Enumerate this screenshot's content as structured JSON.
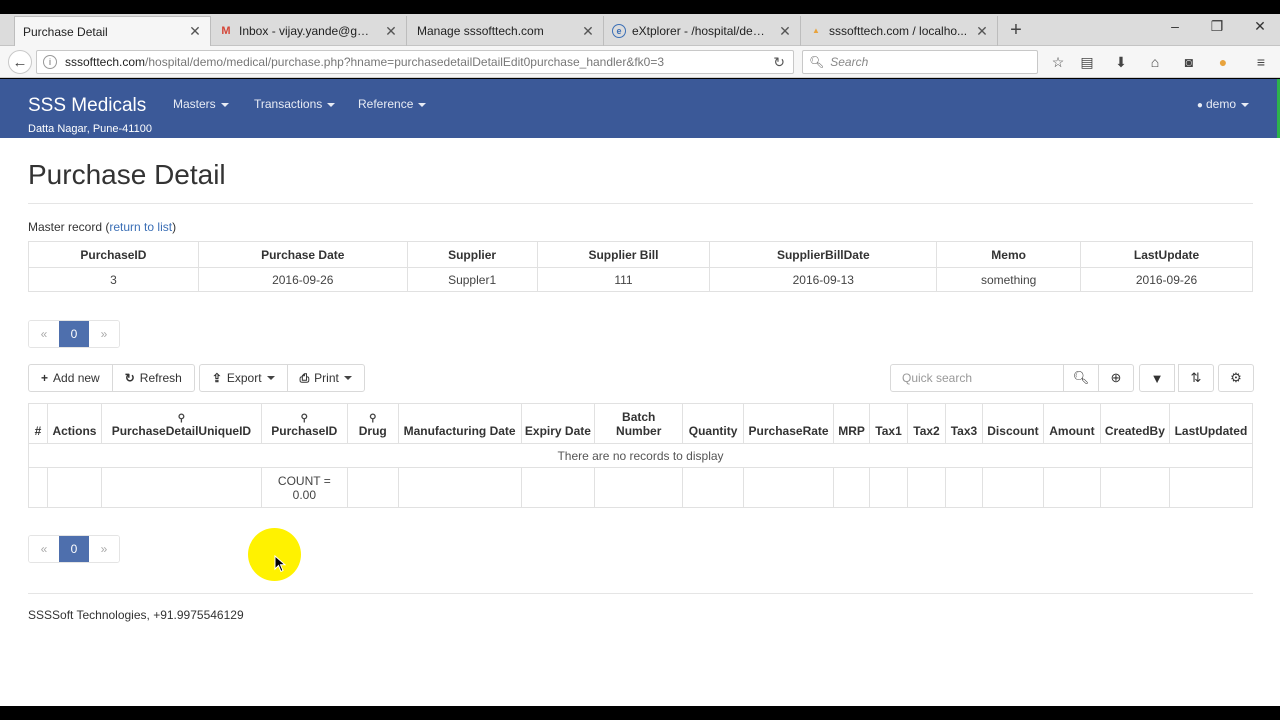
{
  "browser": {
    "tabs": [
      {
        "label": "Purchase Detail",
        "icon": "page-icon",
        "active": true
      },
      {
        "label": "Inbox - vijay.yande@gmai...",
        "icon": "gmail-icon"
      },
      {
        "label": "Manage sssofttech.com",
        "icon": "page-icon"
      },
      {
        "label": "eXtplorer - /hospital/dem...",
        "icon": "extplorer-icon"
      },
      {
        "label": "sssofttech.com / localho...",
        "icon": "phpmyadmin-icon"
      }
    ],
    "url_host": "sssofttech.com",
    "url_path": "/hospital/demo/medical/purchase.php?hname=purchasedetailDetailEdit0purchase_handler&fk0=3",
    "search_placeholder": "Search"
  },
  "app": {
    "brand": "SSS Medicals",
    "address": "Datta Nagar, Pune-41100",
    "menus": [
      "Masters",
      "Transactions",
      "Reference"
    ],
    "user": "demo",
    "nav_color": "#3b5998"
  },
  "page": {
    "title": "Purchase Detail",
    "master_label": "Master record",
    "return_link": "return to list",
    "master_table": {
      "headers": [
        "PurchaseID",
        "Purchase Date",
        "Supplier",
        "Supplier Bill",
        "SupplierBillDate",
        "Memo",
        "LastUpdate"
      ],
      "row": [
        "3",
        "2016-09-26",
        "Suppler1",
        "111",
        "2016-09-13",
        "something",
        "2016-09-26"
      ]
    },
    "pager": {
      "prev": "«",
      "current": "0",
      "next": "»"
    },
    "toolbar": {
      "add_new": "Add new",
      "refresh": "Refresh",
      "export": "Export",
      "print": "Print",
      "quick_search_placeholder": "Quick search"
    },
    "detail_table": {
      "headers": [
        "#",
        "Actions",
        "PurchaseDetailUniqueID",
        "PurchaseID",
        "Drug",
        "Manufacturing Date",
        "Expiry Date",
        "Batch Number",
        "Quantity",
        "PurchaseRate",
        "MRP",
        "Tax1",
        "Tax2",
        "Tax3",
        "Discount",
        "Amount",
        "CreatedBy",
        "LastUpdated"
      ],
      "no_records": "There are no records to display",
      "count_label": "COUNT =",
      "count_value": "0.00"
    },
    "footer": "SSSSoft Technologies, +91.9975546129"
  }
}
